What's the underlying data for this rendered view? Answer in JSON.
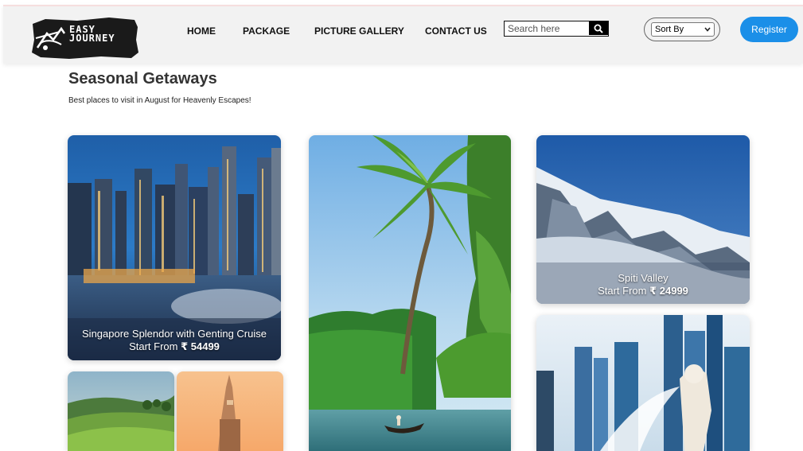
{
  "header": {
    "logo": {
      "line1": "EASY",
      "line2": "JOURNEY"
    },
    "nav": [
      {
        "label": "HOME"
      },
      {
        "label": "PACKAGE"
      },
      {
        "label": "PICTURE GALLERY"
      },
      {
        "label": "CONTACT US"
      }
    ],
    "search": {
      "placeholder": "Search here",
      "icon": "search-icon"
    },
    "sort": {
      "selected": "Sort By",
      "icon": "chevron-down-icon"
    },
    "register_label": "Register"
  },
  "main": {
    "title": "Seasonal Getaways",
    "subtitle": "Best places to visit in August for Heavenly Escapes!",
    "cards": [
      {
        "title": "Singapore Splendor with Genting Cruise",
        "price_prefix": "Start From",
        "price": "₹ 54499"
      },
      {
        "title": "Spiti Valley",
        "price_prefix": "Start From",
        "price": "₹ 24999"
      }
    ]
  },
  "colors": {
    "accent": "#1b8fe8",
    "header_bg": "#f2f2f2",
    "text_dark": "#333333"
  }
}
